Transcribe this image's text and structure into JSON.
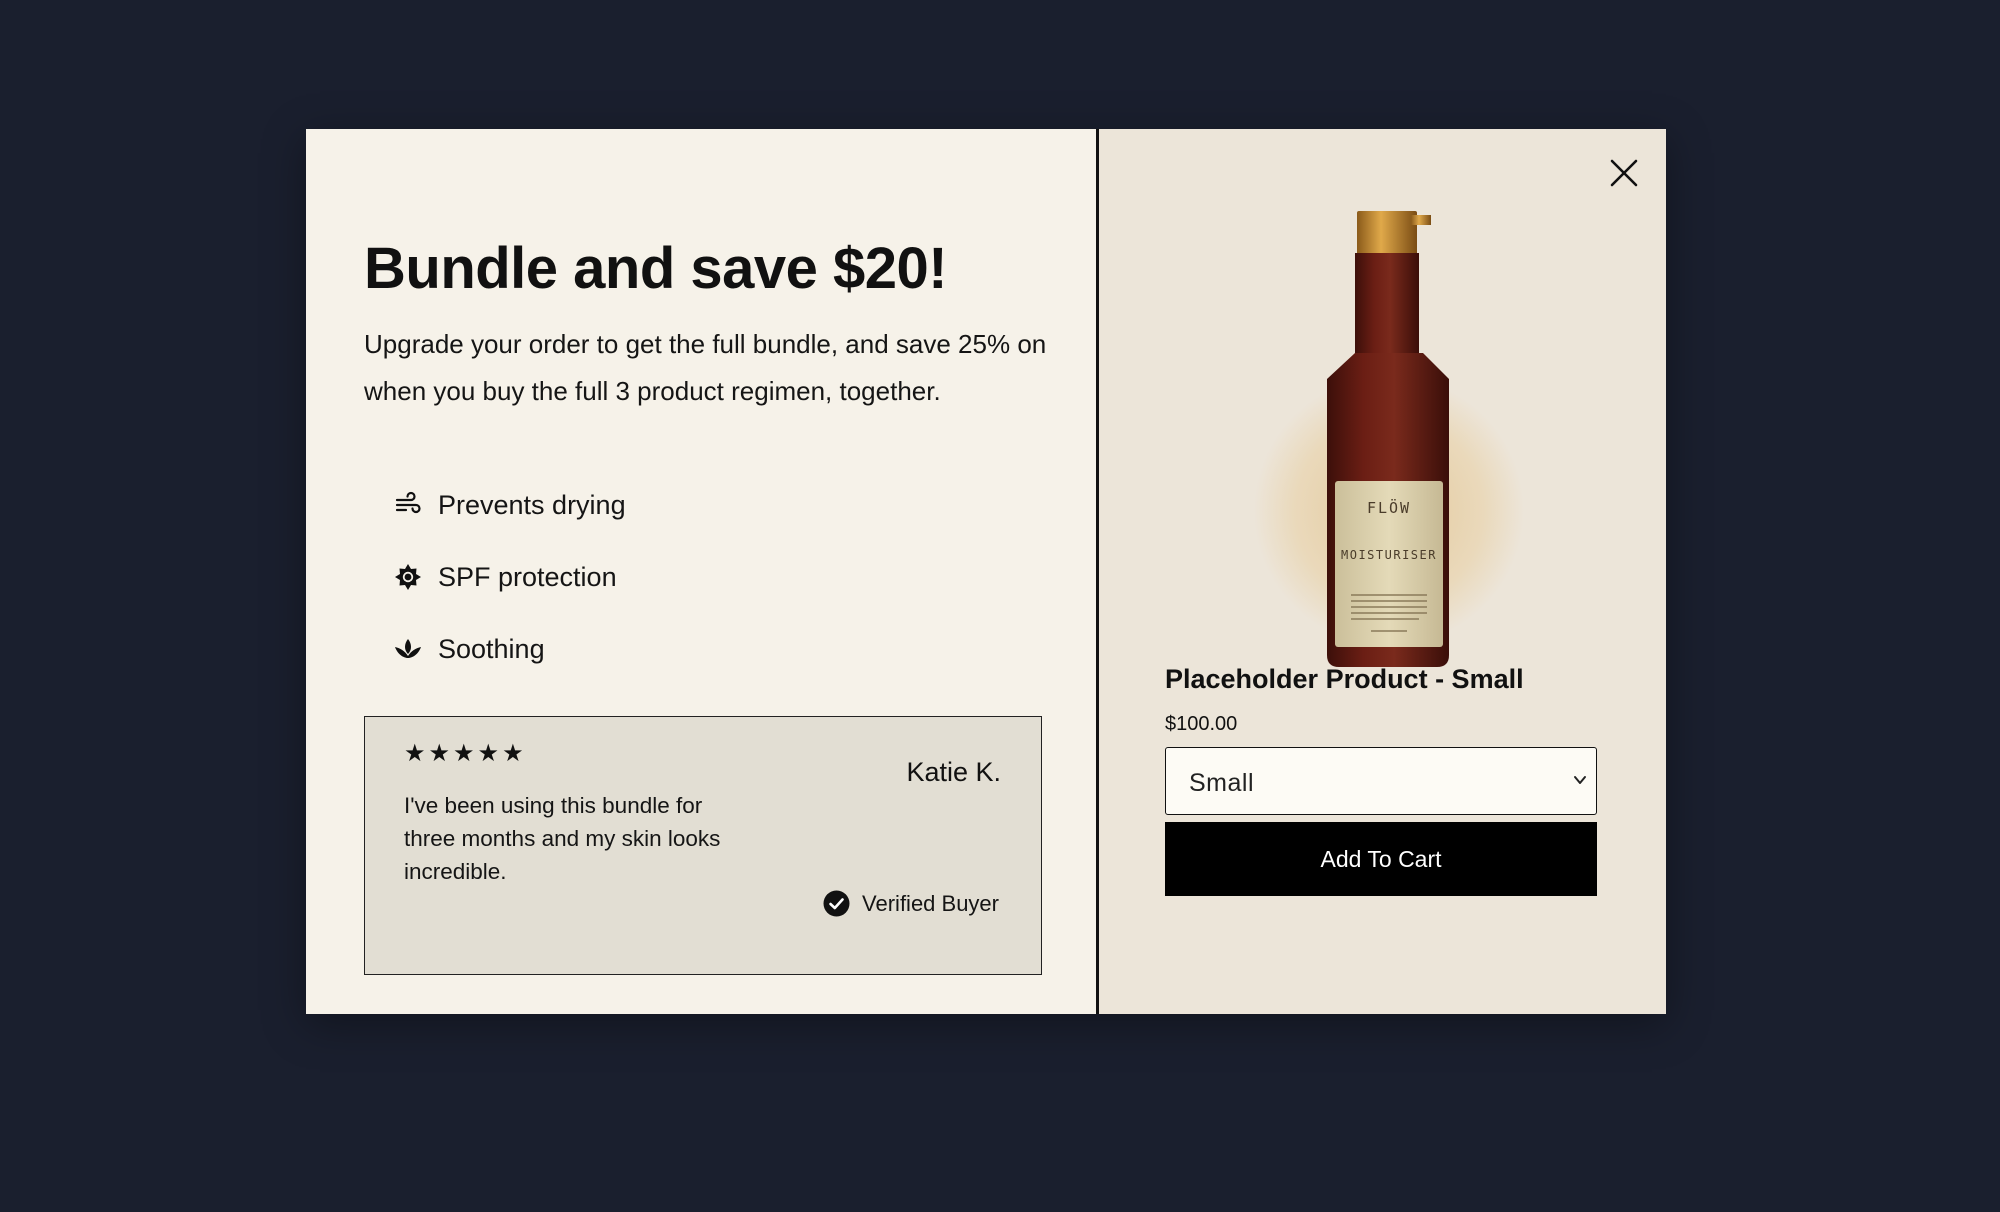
{
  "offer": {
    "headline": "Bundle and save $20!",
    "subtext": "Upgrade your order to get the full bundle, and save 25% on when you buy the full 3 product regimen, together.",
    "benefits": [
      {
        "icon": "wind-icon",
        "label": "Prevents drying"
      },
      {
        "icon": "sun-icon",
        "label": "SPF protection"
      },
      {
        "icon": "lotus-icon",
        "label": "Soothing"
      }
    ]
  },
  "review": {
    "stars": "★★★★★",
    "rating": 5,
    "reviewer": "Katie K.",
    "text": "I've been using this bundle for three months and my skin looks incredible.",
    "verified_label": "Verified Buyer"
  },
  "product": {
    "image_brand": "FLÖW",
    "image_label": "MOISTURISER",
    "name": "Placeholder Product - Small",
    "price": "$100.00",
    "variant_selected": "Small",
    "add_to_cart_label": "Add To Cart"
  },
  "colors": {
    "backdrop": "#1a1f2e",
    "left_panel": "#f6f2e9",
    "right_panel": "#ece5d9",
    "review_card": "#e2ded3",
    "button": "#000000",
    "bottle": "#5a1a12",
    "cap": "#c98a2e"
  }
}
